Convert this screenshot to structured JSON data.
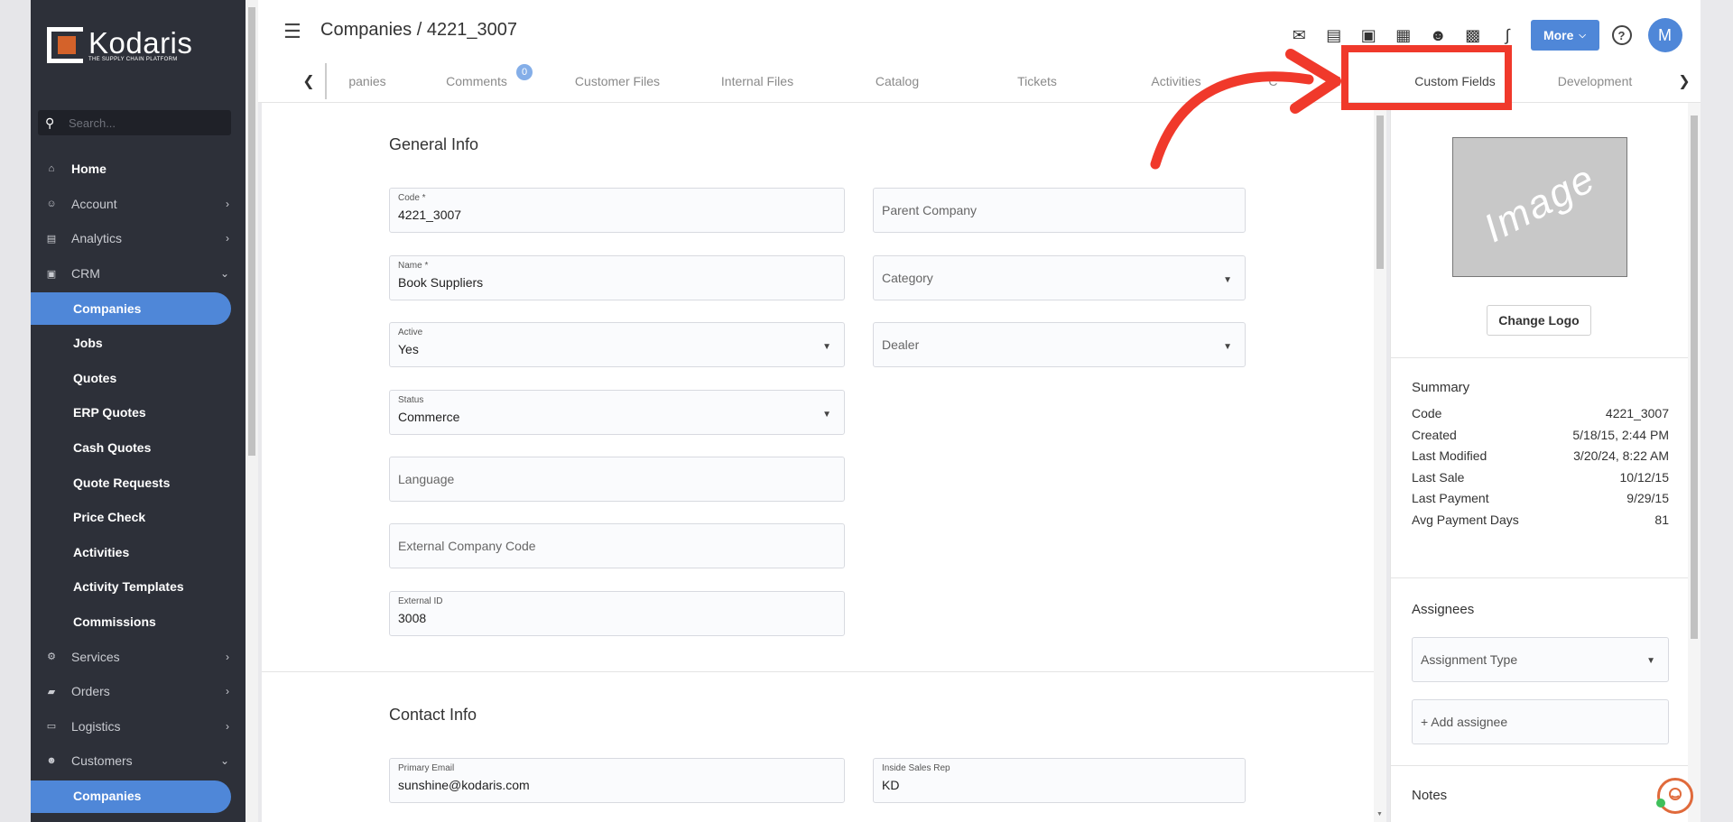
{
  "brand": {
    "name": "Kodaris",
    "tagline": "THE SUPPLY CHAIN PLATFORM"
  },
  "sidebar": {
    "search_placeholder": "Search...",
    "items": [
      {
        "label": "Home",
        "icon": "home-icon",
        "type": "home"
      },
      {
        "label": "Account",
        "icon": "account-icon",
        "type": "group",
        "chevron": "›"
      },
      {
        "label": "Analytics",
        "icon": "analytics-icon",
        "type": "group",
        "chevron": "›"
      },
      {
        "label": "CRM",
        "icon": "crm-icon",
        "type": "group",
        "chevron": "⌄"
      },
      {
        "label": "Companies",
        "type": "sub",
        "active": true
      },
      {
        "label": "Jobs",
        "type": "sub"
      },
      {
        "label": "Quotes",
        "type": "sub"
      },
      {
        "label": "ERP Quotes",
        "type": "sub"
      },
      {
        "label": "Cash Quotes",
        "type": "sub"
      },
      {
        "label": "Quote Requests",
        "type": "sub"
      },
      {
        "label": "Price Check",
        "type": "sub"
      },
      {
        "label": "Activities",
        "type": "sub"
      },
      {
        "label": "Activity Templates",
        "type": "sub"
      },
      {
        "label": "Commissions",
        "type": "sub"
      },
      {
        "label": "Services",
        "icon": "services-icon",
        "type": "group",
        "chevron": "›"
      },
      {
        "label": "Orders",
        "icon": "orders-icon",
        "type": "group",
        "chevron": "›"
      },
      {
        "label": "Logistics",
        "icon": "logistics-icon",
        "type": "group",
        "chevron": "›"
      },
      {
        "label": "Customers",
        "icon": "customers-icon",
        "type": "group",
        "chevron": "⌄"
      },
      {
        "label": "Companies",
        "type": "sub",
        "active": true
      }
    ]
  },
  "header": {
    "title": "Companies / 4221_3007",
    "more_label": "More",
    "avatar_letter": "M",
    "toolbar_icons": [
      "mail-icon",
      "card-check-icon",
      "gift-icon",
      "building-plus-icon",
      "person-add-icon",
      "file-add-icon",
      "paperclip-icon"
    ]
  },
  "tabs": [
    {
      "label": "Companies",
      "visible_text": "panies"
    },
    {
      "label": "Comments",
      "visible_text": "Comments",
      "badge": "0"
    },
    {
      "label": "Customer Files",
      "visible_text": "Customer Files"
    },
    {
      "label": "Internal Files",
      "visible_text": "Internal Files"
    },
    {
      "label": "Catalog",
      "visible_text": "Catalog"
    },
    {
      "label": "Tickets",
      "visible_text": "Tickets"
    },
    {
      "label": "Activities",
      "visible_text": "Activities"
    },
    {
      "label": "Custom Fields (partially hidden)",
      "visible_text": "C                ds"
    },
    {
      "label": "Custom Fields",
      "visible_text": "Custom Fields",
      "active": true
    },
    {
      "label": "Development",
      "visible_text": "Development"
    }
  ],
  "general_info": {
    "title": "General Info",
    "code": {
      "label": "Code *",
      "value": "4221_3007"
    },
    "parent_company": {
      "placeholder": "Parent Company"
    },
    "name": {
      "label": "Name *",
      "value": "Book Suppliers"
    },
    "category": {
      "placeholder": "Category"
    },
    "active": {
      "label": "Active",
      "value": "Yes"
    },
    "dealer": {
      "placeholder": "Dealer"
    },
    "status": {
      "label": "Status",
      "value": "Commerce"
    },
    "language": {
      "placeholder": "Language"
    },
    "external_company_code": {
      "placeholder": "External Company Code"
    },
    "external_id": {
      "label": "External ID",
      "value": "3008"
    }
  },
  "contact_info": {
    "title": "Contact Info",
    "primary_email": {
      "label": "Primary Email",
      "value": "sunshine@kodaris.com"
    },
    "inside_sales_rep": {
      "label": "Inside Sales Rep",
      "value": "KD"
    }
  },
  "right_panel": {
    "logo_placeholder": "Image",
    "change_logo_label": "Change Logo",
    "summary_title": "Summary",
    "summary": [
      {
        "key": "Code",
        "value": "4221_3007"
      },
      {
        "key": "Created",
        "value": "5/18/15, 2:44 PM"
      },
      {
        "key": "Last Modified",
        "value": "3/20/24, 8:22 AM"
      },
      {
        "key": "Last Sale",
        "value": "10/12/15"
      },
      {
        "key": "Last Payment",
        "value": "9/29/15"
      },
      {
        "key": "Avg Payment Days",
        "value": "81"
      }
    ],
    "assignees_title": "Assignees",
    "assignment_type_placeholder": "Assignment Type",
    "add_assignee_label": "+ Add assignee",
    "notes_title": "Notes"
  },
  "colors": {
    "sidebar_bg": "#2d3039",
    "accent": "#4f87d8",
    "brand_orange": "#d4622a",
    "annotation_red": "#f0392b"
  }
}
